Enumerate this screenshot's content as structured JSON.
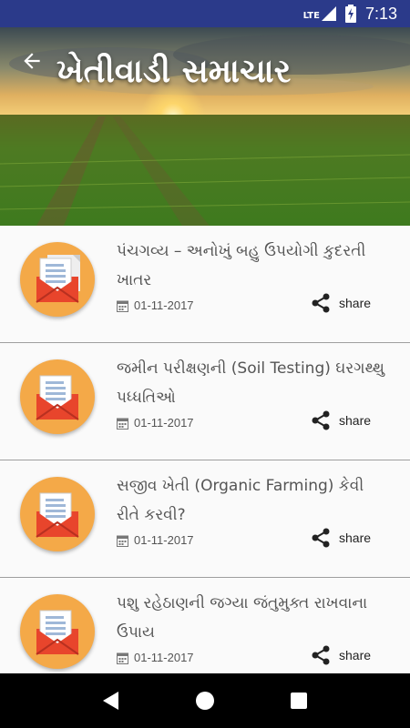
{
  "status_bar": {
    "network": "LTE",
    "time": "7:13"
  },
  "header": {
    "title": "ખેતીવાડી સમાચાર",
    "back_icon": "arrow-left-icon"
  },
  "articles": [
    {
      "title": "પંચગવ્ય – અનોખું બહુ ઉપયોગી કુદરતી ખાતર",
      "date": "01-11-2017",
      "share_label": "share"
    },
    {
      "title": "જમીન પરીક્ષણની (Soil Testing) ઘરગથ્થુ પધ્ધતિઓ",
      "date": "01-11-2017",
      "share_label": "share"
    },
    {
      "title": "સજીવ ખેતી (Organic Farming) કેવી રીતે કરવી?",
      "date": "01-11-2017",
      "share_label": "share"
    },
    {
      "title": "પશુ રહેઠાણની જગ્યા જંતુમુક્ત રાખવાના ઉપાય",
      "date": "01-11-2017",
      "share_label": "share"
    }
  ],
  "nav": {
    "back_icon": "triangle-back-icon",
    "home_icon": "circle-home-icon",
    "recents_icon": "square-recents-icon"
  },
  "colors": {
    "status_bar": "#2b3a8a",
    "icon_circle": "#f4a948",
    "envelope": "#e8452c"
  }
}
